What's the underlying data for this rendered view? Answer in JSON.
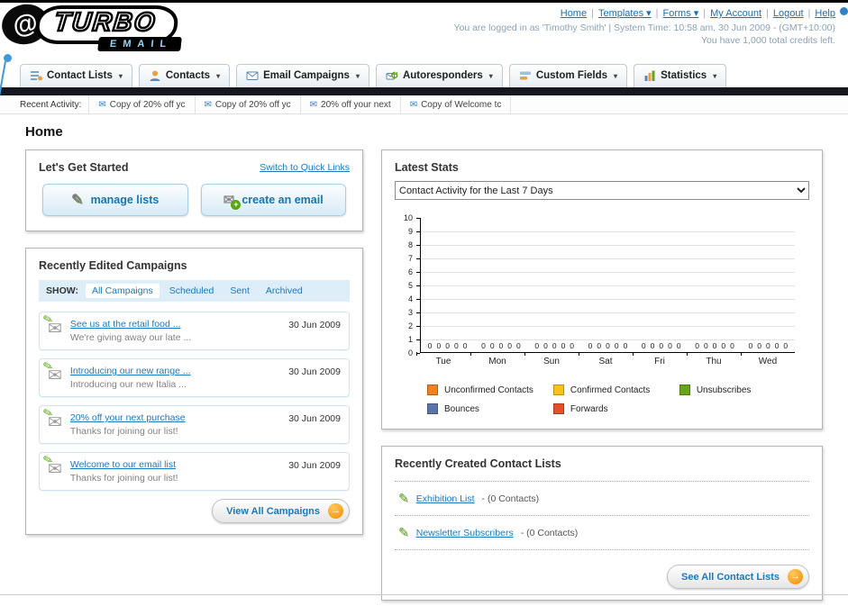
{
  "page_title": "Home",
  "colors": {
    "link": "#1b79c0",
    "dark_bar": "#16171f",
    "arrow_orange": "#f28a00"
  },
  "header": {
    "logo_top": "TURBO",
    "logo_bottom": "EMAIL",
    "nav": [
      {
        "label": "Home",
        "dropdown": false
      },
      {
        "label": "Templates",
        "dropdown": true
      },
      {
        "label": "Forms",
        "dropdown": true
      },
      {
        "label": "My Account",
        "dropdown": false
      },
      {
        "label": "Logout",
        "dropdown": false
      },
      {
        "label": "Help",
        "dropdown": false
      }
    ],
    "login_info": "You are logged in as 'Timothy Smith' | System Time: 10:58 am, 30 Jun 2009 - (GMT+10:00)",
    "credits_info": "You have 1,000 total credits left."
  },
  "main_nav": [
    {
      "label": "Contact Lists",
      "icon": "contact-lists-icon"
    },
    {
      "label": "Contacts",
      "icon": "contacts-icon"
    },
    {
      "label": "Email Campaigns",
      "icon": "email-campaigns-icon"
    },
    {
      "label": "Autoresponders",
      "icon": "autoresponders-icon"
    },
    {
      "label": "Custom Fields",
      "icon": "custom-fields-icon"
    },
    {
      "label": "Statistics",
      "icon": "statistics-icon"
    }
  ],
  "recent_activity": {
    "label": "Recent Activity:",
    "items": [
      "Copy of 20% off yc",
      "Copy of 20% off yc",
      "20% off your next",
      "Copy of Welcome tc"
    ]
  },
  "get_started": {
    "title": "Let's Get Started",
    "switch_link": "Switch to Quick Links",
    "manage_label": "manage lists",
    "create_label": "create an email"
  },
  "campaigns": {
    "title": "Recently Edited Campaigns",
    "show_label": "SHOW:",
    "tabs": [
      "All Campaigns",
      "Scheduled",
      "Sent",
      "Archived"
    ],
    "items": [
      {
        "title": "See us at the retail food ...",
        "subtitle": "We're giving away our late ...",
        "date": "30 Jun 2009"
      },
      {
        "title": "Introducing our new range ...",
        "subtitle": "Introducing our new Italia ...",
        "date": "30 Jun 2009"
      },
      {
        "title": "20% off your next purchase",
        "subtitle": "Thanks for joining our list!",
        "date": "30 Jun 2009"
      },
      {
        "title": "Welcome to our email list",
        "subtitle": "Thanks for joining our list!",
        "date": "30 Jun 2009"
      }
    ],
    "view_all": "View All Campaigns"
  },
  "stats": {
    "title": "Latest Stats",
    "dropdown_value": "Contact Activity for the Last 7 Days",
    "chart_data": {
      "type": "bar",
      "title": "Contact Activity for the Last 7 Days",
      "categories": [
        "Tue",
        "Mon",
        "Sun",
        "Sat",
        "Fri",
        "Thu",
        "Wed"
      ],
      "series": [
        {
          "name": "Unconfirmed Contacts",
          "color": "#f28020",
          "values": [
            0,
            0,
            0,
            0,
            0,
            0,
            0
          ]
        },
        {
          "name": "Confirmed Contacts",
          "color": "#fcc21b",
          "values": [
            0,
            0,
            0,
            0,
            0,
            0,
            0
          ]
        },
        {
          "name": "Unsubscribes",
          "color": "#68a618",
          "values": [
            0,
            0,
            0,
            0,
            0,
            0,
            0
          ]
        },
        {
          "name": "Bounces",
          "color": "#5b74a8",
          "values": [
            0,
            0,
            0,
            0,
            0,
            0,
            0
          ]
        },
        {
          "name": "Forwards",
          "color": "#e2512a",
          "values": [
            0,
            0,
            0,
            0,
            0,
            0,
            0
          ]
        }
      ],
      "xlabel": "",
      "ylabel": "",
      "ylim": [
        0,
        10
      ],
      "yticks": [
        0,
        1,
        2,
        3,
        4,
        5,
        6,
        7,
        8,
        9,
        10
      ],
      "grid": true,
      "legend_position": "bottom"
    }
  },
  "contact_lists": {
    "title": "Recently Created Contact Lists",
    "items": [
      {
        "name": "Exhibition List",
        "detail": "- (0 Contacts)"
      },
      {
        "name": "Newsletter Subscribers",
        "detail": "- (0 Contacts)"
      }
    ],
    "see_all": "See All Contact Lists"
  }
}
